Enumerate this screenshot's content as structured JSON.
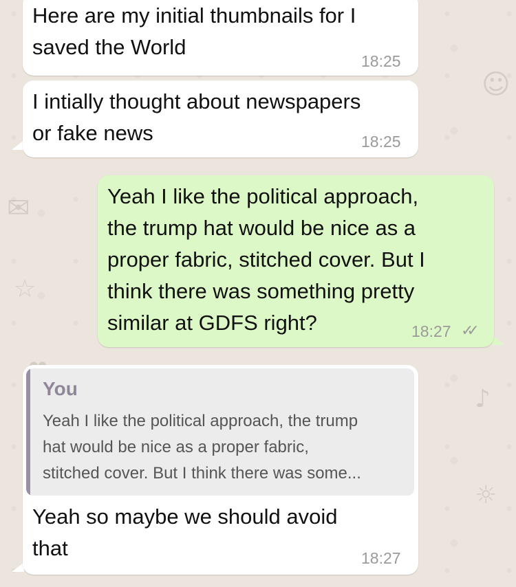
{
  "messages": [
    {
      "direction": "incoming",
      "text": "Here are my initial thumbnails for I\nsaved the World",
      "time": "18:25"
    },
    {
      "direction": "incoming",
      "text": "I intially thought about newspapers\nor fake news",
      "time": "18:25"
    },
    {
      "direction": "outgoing",
      "text": "Yeah I like the political approach,\nthe trump hat would be nice as a\nproper fabric, stitched cover. But I\nthink there was something pretty\nsimilar at GDFS right?",
      "time": "18:27",
      "status_icon": "double-check-icon"
    },
    {
      "direction": "incoming",
      "quote": {
        "author": "You",
        "text": "Yeah I like the political approach, the trump\nhat would be nice as a proper fabric,\nstitched cover. But I think there was some..."
      },
      "text": "Yeah so maybe we should avoid\nthat",
      "time": "18:27"
    }
  ],
  "colors": {
    "incoming_bubble": "#ffffff",
    "outgoing_bubble": "#dcf8c6",
    "wallpaper": "#ece5dd",
    "quote_bar": "#9b8fa6"
  }
}
